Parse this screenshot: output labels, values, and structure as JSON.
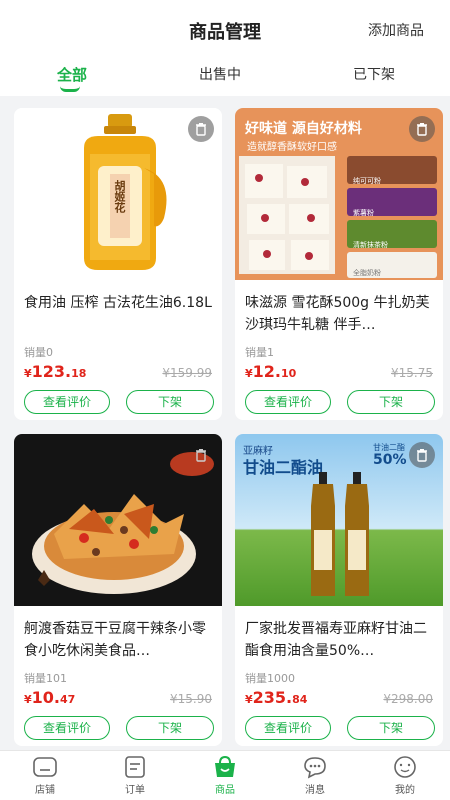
{
  "header": {
    "title": "商品管理",
    "add_label": "添加商品"
  },
  "tabs": [
    {
      "label": "全部",
      "active": true
    },
    {
      "label": "出售中",
      "active": false
    },
    {
      "label": "已下架",
      "active": false
    }
  ],
  "products": [
    {
      "name": "食用油 压榨 古法花生油6.18L",
      "sales": "销量0",
      "price_currency": "¥",
      "price_int": "123.",
      "price_dec": "18",
      "original_price": "¥159.99",
      "review_label": "查看评价",
      "off_label": "下架",
      "image_text": "胡姬花"
    },
    {
      "name": "味滋源 雪花酥500g 牛扎奶芙沙琪玛牛轧糖 伴手…",
      "sales": "销量1",
      "price_currency": "¥",
      "price_int": "12.",
      "price_dec": "10",
      "original_price": "¥15.75",
      "review_label": "查看评价",
      "off_label": "下架",
      "image_title": "好味道 源自好材料",
      "image_sub": "造就醇香酥软好口感",
      "image_tags": [
        "纯可可粉",
        "紫薯粉",
        "清新抹茶粉",
        "全脂奶粉"
      ]
    },
    {
      "name": "舸渡香菇豆干豆腐干辣条小零食小吃休闲美食品…",
      "sales": "销量101",
      "price_currency": "¥",
      "price_int": "10.",
      "price_dec": "47",
      "original_price": "¥15.90",
      "review_label": "查看评价",
      "off_label": "下架"
    },
    {
      "name": "厂家批发晋福寿亚麻籽甘油二酯食用油含量50%…",
      "sales": "销量1000",
      "price_currency": "¥",
      "price_int": "235.",
      "price_dec": "84",
      "original_price": "¥298.00",
      "review_label": "查看评价",
      "off_label": "下架",
      "image_top_left": "亚麻籽",
      "image_big": "甘油二酯油",
      "image_top_right": "甘油二酯",
      "image_pct": "50%"
    }
  ],
  "tabbar": [
    {
      "label": "店铺",
      "icon": "shop-icon",
      "active": false
    },
    {
      "label": "订单",
      "icon": "order-icon",
      "active": false
    },
    {
      "label": "商品",
      "icon": "bag-icon",
      "active": true
    },
    {
      "label": "消息",
      "icon": "message-icon",
      "active": false
    },
    {
      "label": "我的",
      "icon": "profile-icon",
      "active": false
    }
  ],
  "colors": {
    "accent": "#1bb24a",
    "price": "#e0241b"
  }
}
